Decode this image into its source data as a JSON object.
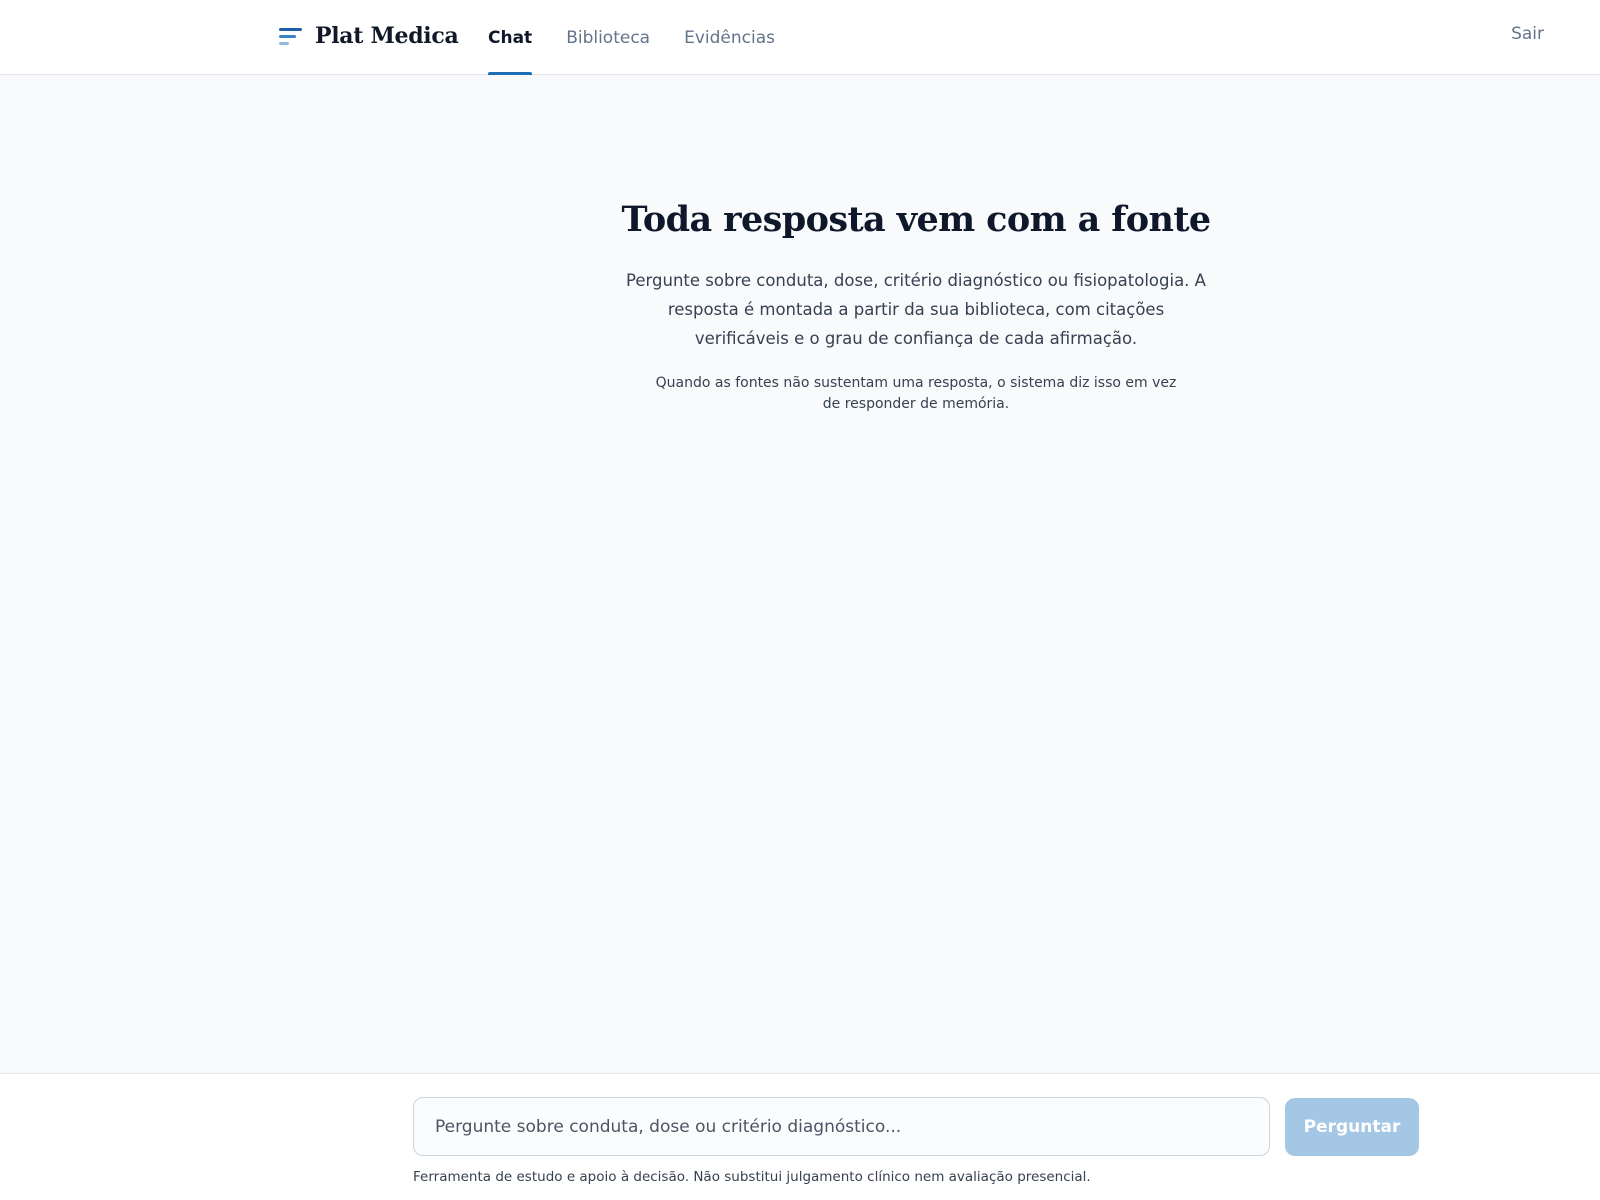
{
  "header": {
    "brand": "Plat Medica",
    "brand_icon": "menu-lines-icon",
    "tabs": [
      {
        "label": "Chat",
        "active": true
      },
      {
        "label": "Biblioteca",
        "active": false
      },
      {
        "label": "Evidências",
        "active": false
      }
    ],
    "logout_label": "Sair"
  },
  "hero": {
    "title": "Toda resposta vem com a fonte",
    "description": "Pergunte sobre conduta, dose, critério diagnóstico ou fisiopatologia. A resposta é montada a partir da sua biblioteca, com citações verificáveis e o grau de confiança de cada afirmação.",
    "note": "Quando as fontes não sustentam uma resposta, o sistema diz isso em vez de responder de memória."
  },
  "composer": {
    "input_value": "",
    "placeholder": "Pergunte sobre conduta, dose ou critério diagnóstico...",
    "submit_label": "Perguntar",
    "disclaimer": "Ferramenta de estudo e apoio à decisão. Não substitui julgamento clínico nem avaliação presencial."
  },
  "colors": {
    "accent": "#1d6fb8",
    "button_disabled": "#a5c7e6",
    "page_background": "#f8fafc"
  }
}
